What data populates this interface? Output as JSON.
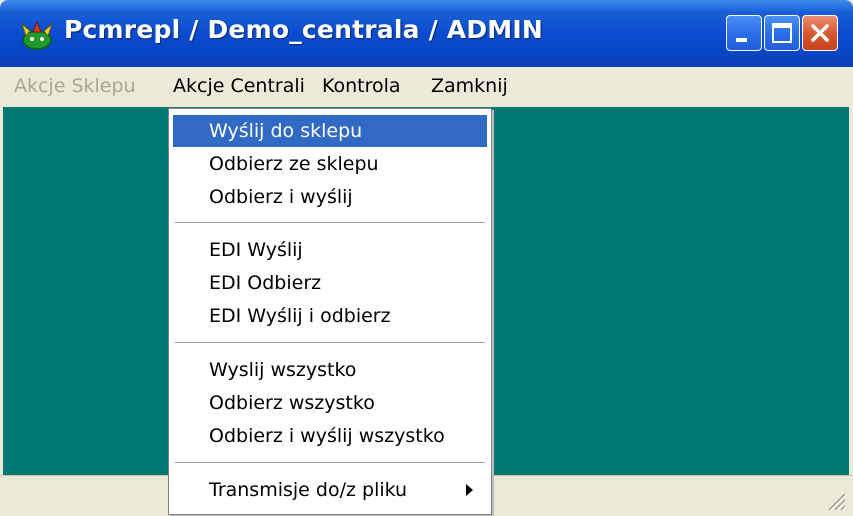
{
  "window": {
    "title": "Pcmrepl / Demo_centrala / ADMIN",
    "title_color": "#ffffff",
    "titlebar_color": "#0a4bd0"
  },
  "menubar": {
    "items": [
      {
        "label": "Akcje Sklepu",
        "enabled": false
      },
      {
        "label": "Akcje Centrali",
        "enabled": true,
        "open": true
      },
      {
        "label": "Kontrola",
        "enabled": true
      },
      {
        "label": "Zamknij",
        "enabled": true
      }
    ]
  },
  "dropdown": {
    "groups": [
      [
        "Wyślij do sklepu",
        "Odbierz ze sklepu",
        "Odbierz i wyślij"
      ],
      [
        "EDI Wyślij",
        "EDI Odbierz",
        "EDI Wyślij i odbierz"
      ],
      [
        "Wyslij wszystko",
        "Odbierz wszystko",
        "Odbierz i wyślij wszystko"
      ],
      [
        "Transmisje do/z pliku"
      ]
    ],
    "selected": "Wyślij do sklepu",
    "submenu_item": "Transmisje do/z pliku"
  },
  "colors": {
    "client_background": "#007770",
    "selection": "#316ac5",
    "close_button": "#d85a32",
    "disabled_text": "#aca899"
  },
  "icons": {
    "app": "app-icon",
    "minimize": "minimize-icon",
    "maximize": "maximize-icon",
    "close": "close-icon",
    "submenu": "submenu-arrow-icon",
    "resize": "resize-grip-icon"
  }
}
